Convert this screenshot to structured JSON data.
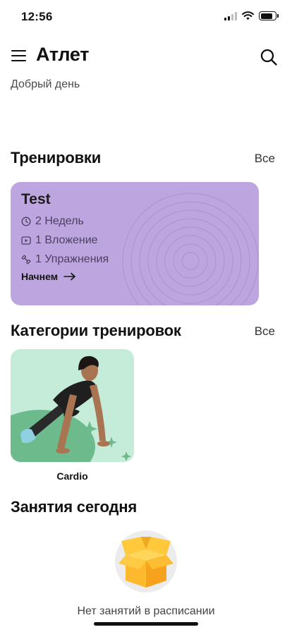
{
  "status_bar": {
    "time": "12:56",
    "battery_level": 0.85
  },
  "header": {
    "title": "Атлет",
    "menu_icon": "hamburger-menu-icon",
    "search_icon": "search-icon"
  },
  "greeting": "Добрый день",
  "workouts_section": {
    "title": "Тренировки",
    "see_all": "Все",
    "card": {
      "title": "Test",
      "duration": "2 Недель",
      "attachments": "1 Вложение",
      "exercises": "1 Упражнения",
      "cta": "Начнем",
      "background_color": "#bda6e0"
    }
  },
  "categories_section": {
    "title": "Категории тренировок",
    "see_all": "Все",
    "items": [
      {
        "label": "Cardio",
        "background_color": "#c5ecd8"
      }
    ]
  },
  "today_section": {
    "title": "Занятия сегодня",
    "empty_text": "Нет занятий в расписании",
    "empty_icon": "open-box-icon"
  }
}
